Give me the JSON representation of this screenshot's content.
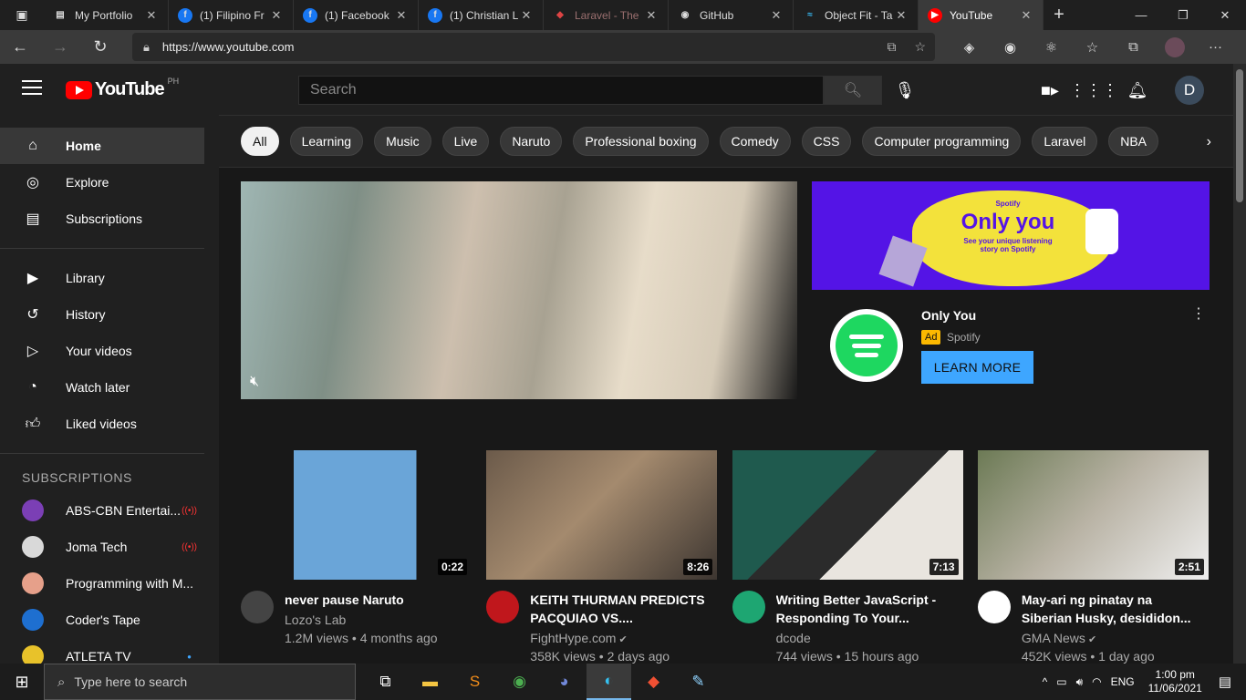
{
  "browser": {
    "tabs": [
      {
        "title": "My Portfolio",
        "icon": "document-icon",
        "state": "normal"
      },
      {
        "title": "(1) Filipino Fr",
        "icon": "facebook-icon",
        "state": "normal"
      },
      {
        "title": "(1) Facebook",
        "icon": "facebook-icon",
        "state": "normal"
      },
      {
        "title": "(1) Christian L",
        "icon": "facebook-icon",
        "state": "normal"
      },
      {
        "title": "Laravel - The",
        "icon": "laravel-icon",
        "state": "dim"
      },
      {
        "title": "GitHub",
        "icon": "github-icon",
        "state": "normal"
      },
      {
        "title": "Object Fit - Ta",
        "icon": "tailwind-icon",
        "state": "normal"
      },
      {
        "title": "YouTube",
        "icon": "youtube-icon",
        "state": "active"
      }
    ],
    "url": "https://www.youtube.com"
  },
  "youtube": {
    "logo_text": "YouTube",
    "country_code": "PH",
    "search_placeholder": "Search",
    "user_initial": "D",
    "sidebar": {
      "main": [
        {
          "label": "Home",
          "icon": "home-icon",
          "active": true
        },
        {
          "label": "Explore",
          "icon": "compass-icon"
        },
        {
          "label": "Subscriptions",
          "icon": "subscriptions-icon"
        }
      ],
      "library": [
        {
          "label": "Library",
          "icon": "library-icon"
        },
        {
          "label": "History",
          "icon": "history-icon"
        },
        {
          "label": "Your videos",
          "icon": "your-videos-icon"
        },
        {
          "label": "Watch later",
          "icon": "clock-icon"
        },
        {
          "label": "Liked videos",
          "icon": "thumbs-up-icon"
        }
      ],
      "subscriptions_title": "SUBSCRIPTIONS",
      "subscriptions": [
        {
          "label": "ABS-CBN Entertai...",
          "indicator": "live",
          "avatar_color": "#7b3fb5"
        },
        {
          "label": "Joma Tech",
          "indicator": "live",
          "avatar_color": "#d9d9d9"
        },
        {
          "label": "Programming with M...",
          "indicator": "",
          "avatar_color": "#e6a08a"
        },
        {
          "label": "Coder's Tape",
          "indicator": "",
          "avatar_color": "#1e6fd0"
        },
        {
          "label": "ATLETA TV",
          "indicator": "new",
          "avatar_color": "#e8c22a"
        }
      ]
    },
    "chips": [
      "All",
      "Learning",
      "Music",
      "Live",
      "Naruto",
      "Professional boxing",
      "Comedy",
      "CSS",
      "Computer programming",
      "Laravel",
      "NBA"
    ],
    "ad": {
      "banner_brand": "Spotify",
      "banner_headline": "Only you",
      "banner_sub": "See your unique listening story on Spotify",
      "title": "Only You",
      "badge": "Ad",
      "advertiser": "Spotify",
      "cta": "LEARN MORE"
    },
    "videos": [
      {
        "title": "never pause Naruto",
        "channel": "Lozo's Lab",
        "views": "1.2M views",
        "age": "4 months ago",
        "duration": "0:22",
        "avatar_color": "#444",
        "one_line": true
      },
      {
        "title": "KEITH THURMAN PREDICTS PACQUIAO VS....",
        "channel": "FightHype.com",
        "verified": true,
        "views": "358K views",
        "age": "2 days ago",
        "duration": "8:26",
        "avatar_color": "#c0171c"
      },
      {
        "title": "Writing Better JavaScript - Responding To Your...",
        "channel": "dcode",
        "views": "744 views",
        "age": "15 hours ago",
        "duration": "7:13",
        "avatar_color": "#1ea672"
      },
      {
        "title": "May-ari ng pinatay na Siberian Husky, desididon...",
        "channel": "GMA News",
        "verified": true,
        "views": "452K views",
        "age": "1 day ago",
        "duration": "2:51",
        "avatar_color": "#ffffff"
      }
    ]
  },
  "taskbar": {
    "search_placeholder": "Type here to search",
    "language": "ENG",
    "time": "1:00 pm",
    "date": "11/06/2021"
  }
}
